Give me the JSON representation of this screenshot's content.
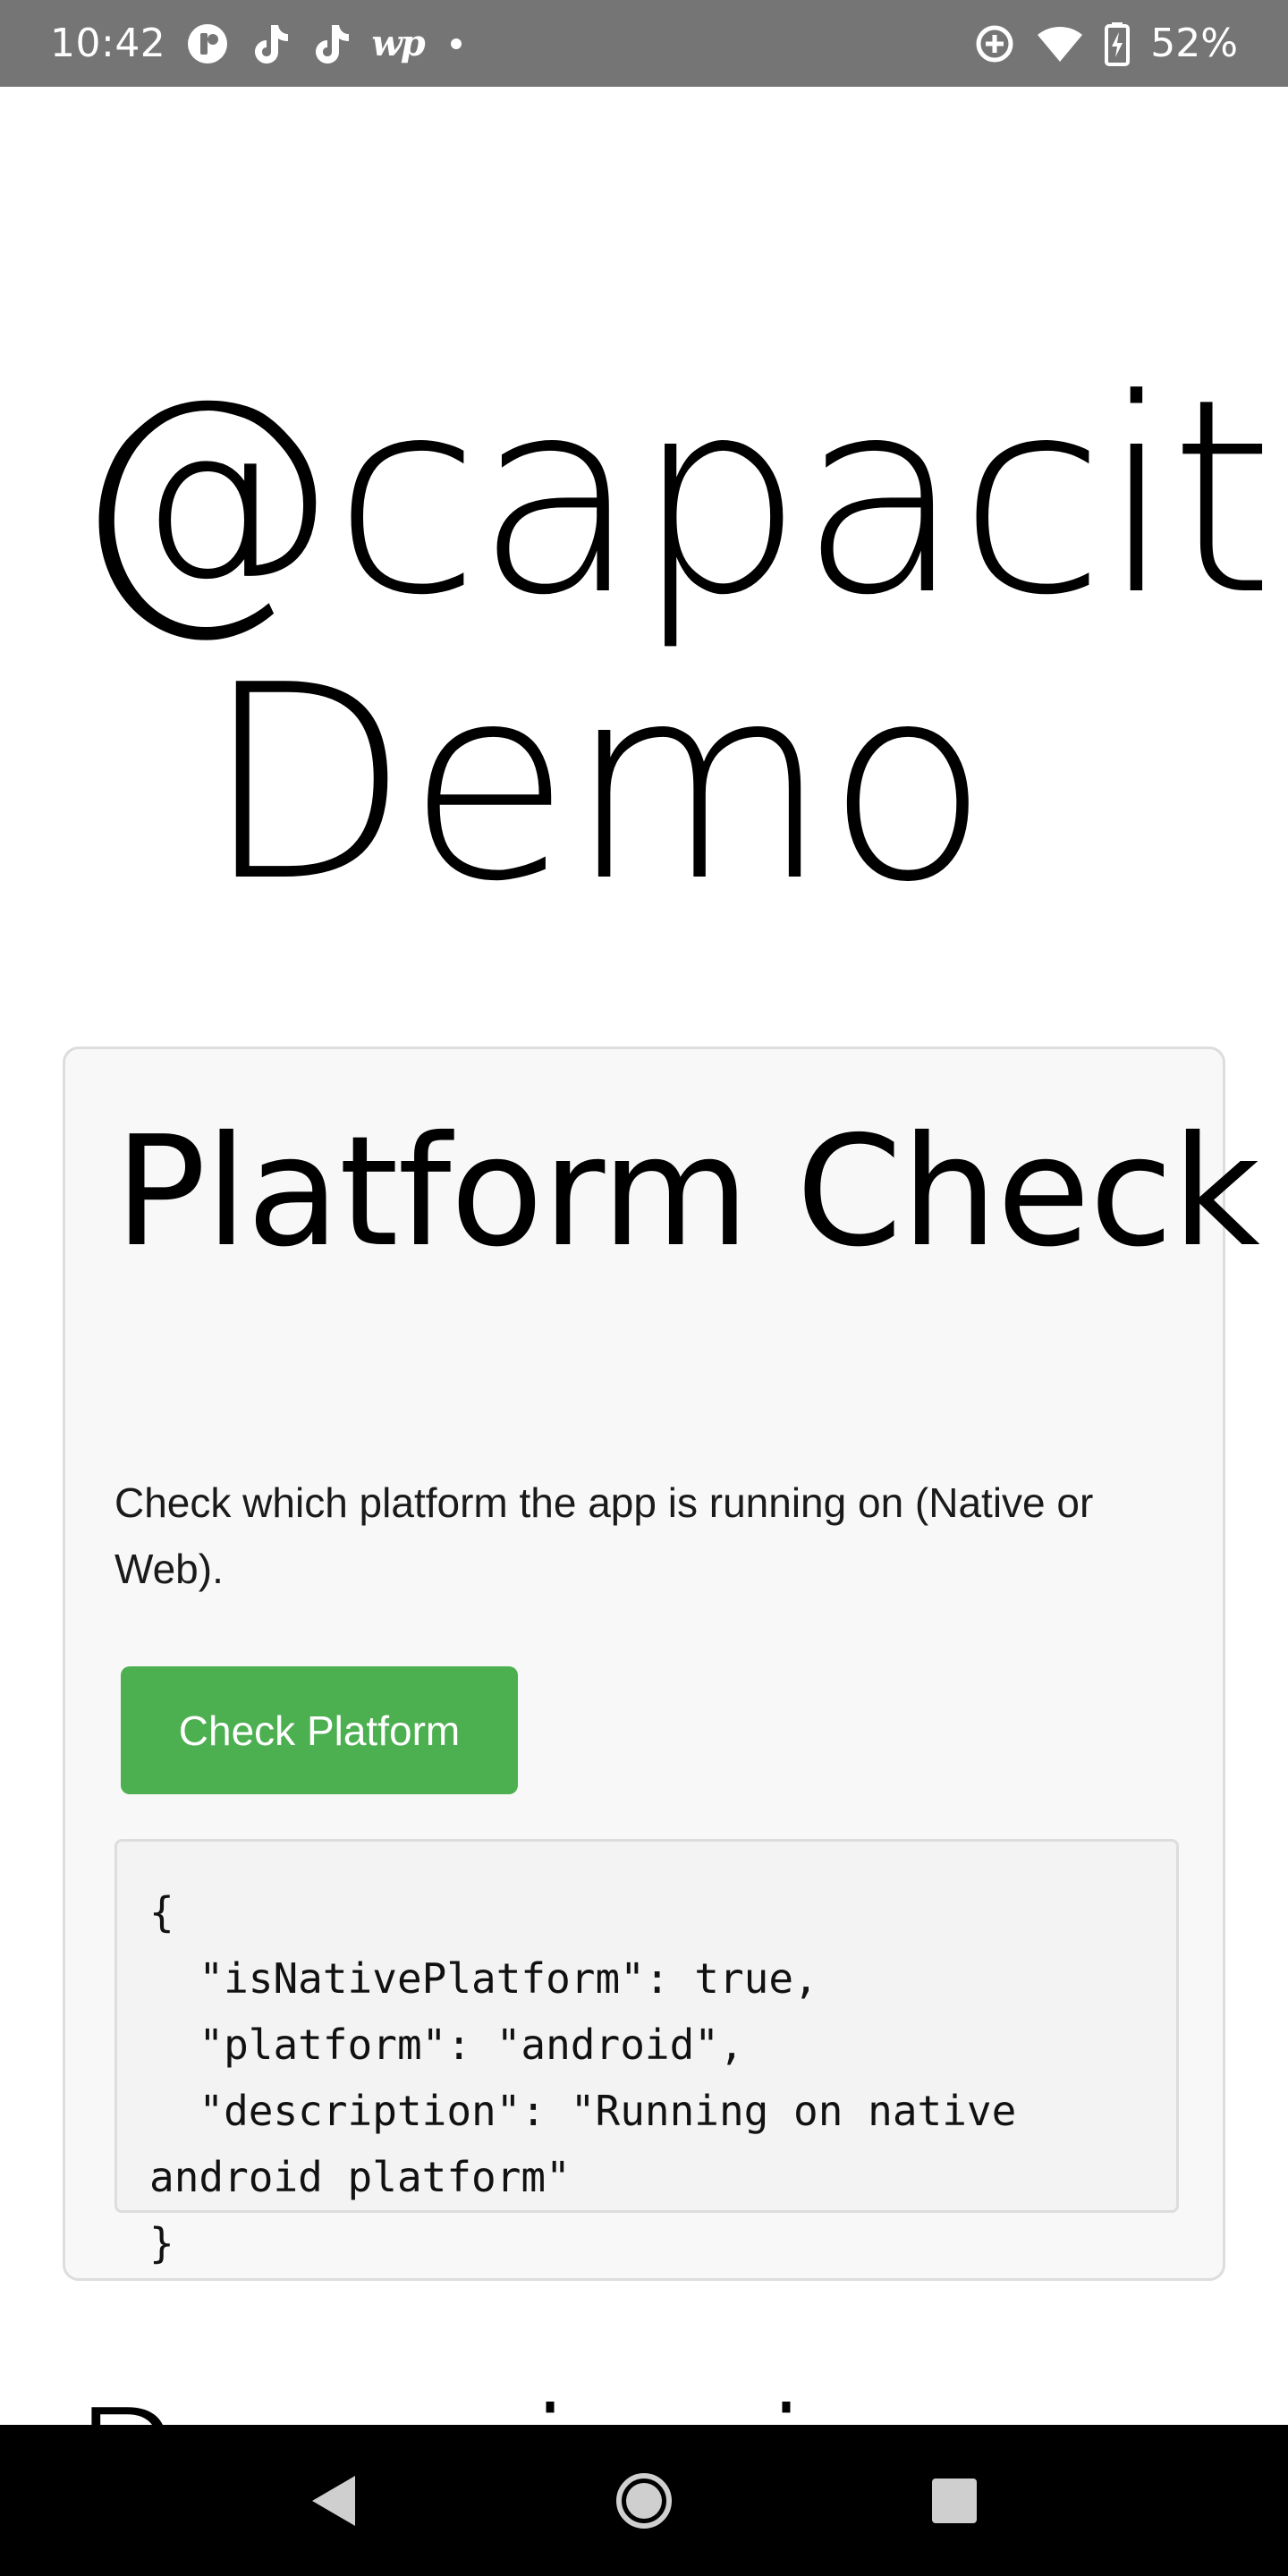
{
  "status_bar": {
    "time": "10:42",
    "left_icons": [
      "notification-app-icon",
      "tiktok-icon",
      "tiktok-icon",
      "washington-post-icon",
      "more-notifications-dot"
    ],
    "wp_label": "wp",
    "right_icons": [
      "data-saver-icon",
      "wifi-icon",
      "battery-charging-icon"
    ],
    "battery_percent": "52%"
  },
  "page": {
    "title_line1": "@capacitor",
    "title_line2": "Demo",
    "next_section_title": "Permissions"
  },
  "card": {
    "title": "Platform Check",
    "description": "Check which platform the app is running on (Native or Web).",
    "button_label": "Check Platform",
    "result_json": "{\n  \"isNativePlatform\": true,\n  \"platform\": \"android\",\n  \"description\": \"Running on native android platform\"\n}"
  },
  "nav_bar": {
    "items": [
      "back-icon",
      "home-icon",
      "recents-icon"
    ]
  },
  "colors": {
    "status_bar": "#757575",
    "button": "#4caf50",
    "card_bg": "#f8f8f8",
    "result_bg": "#f3f3f3",
    "nav_bar": "#000000"
  }
}
